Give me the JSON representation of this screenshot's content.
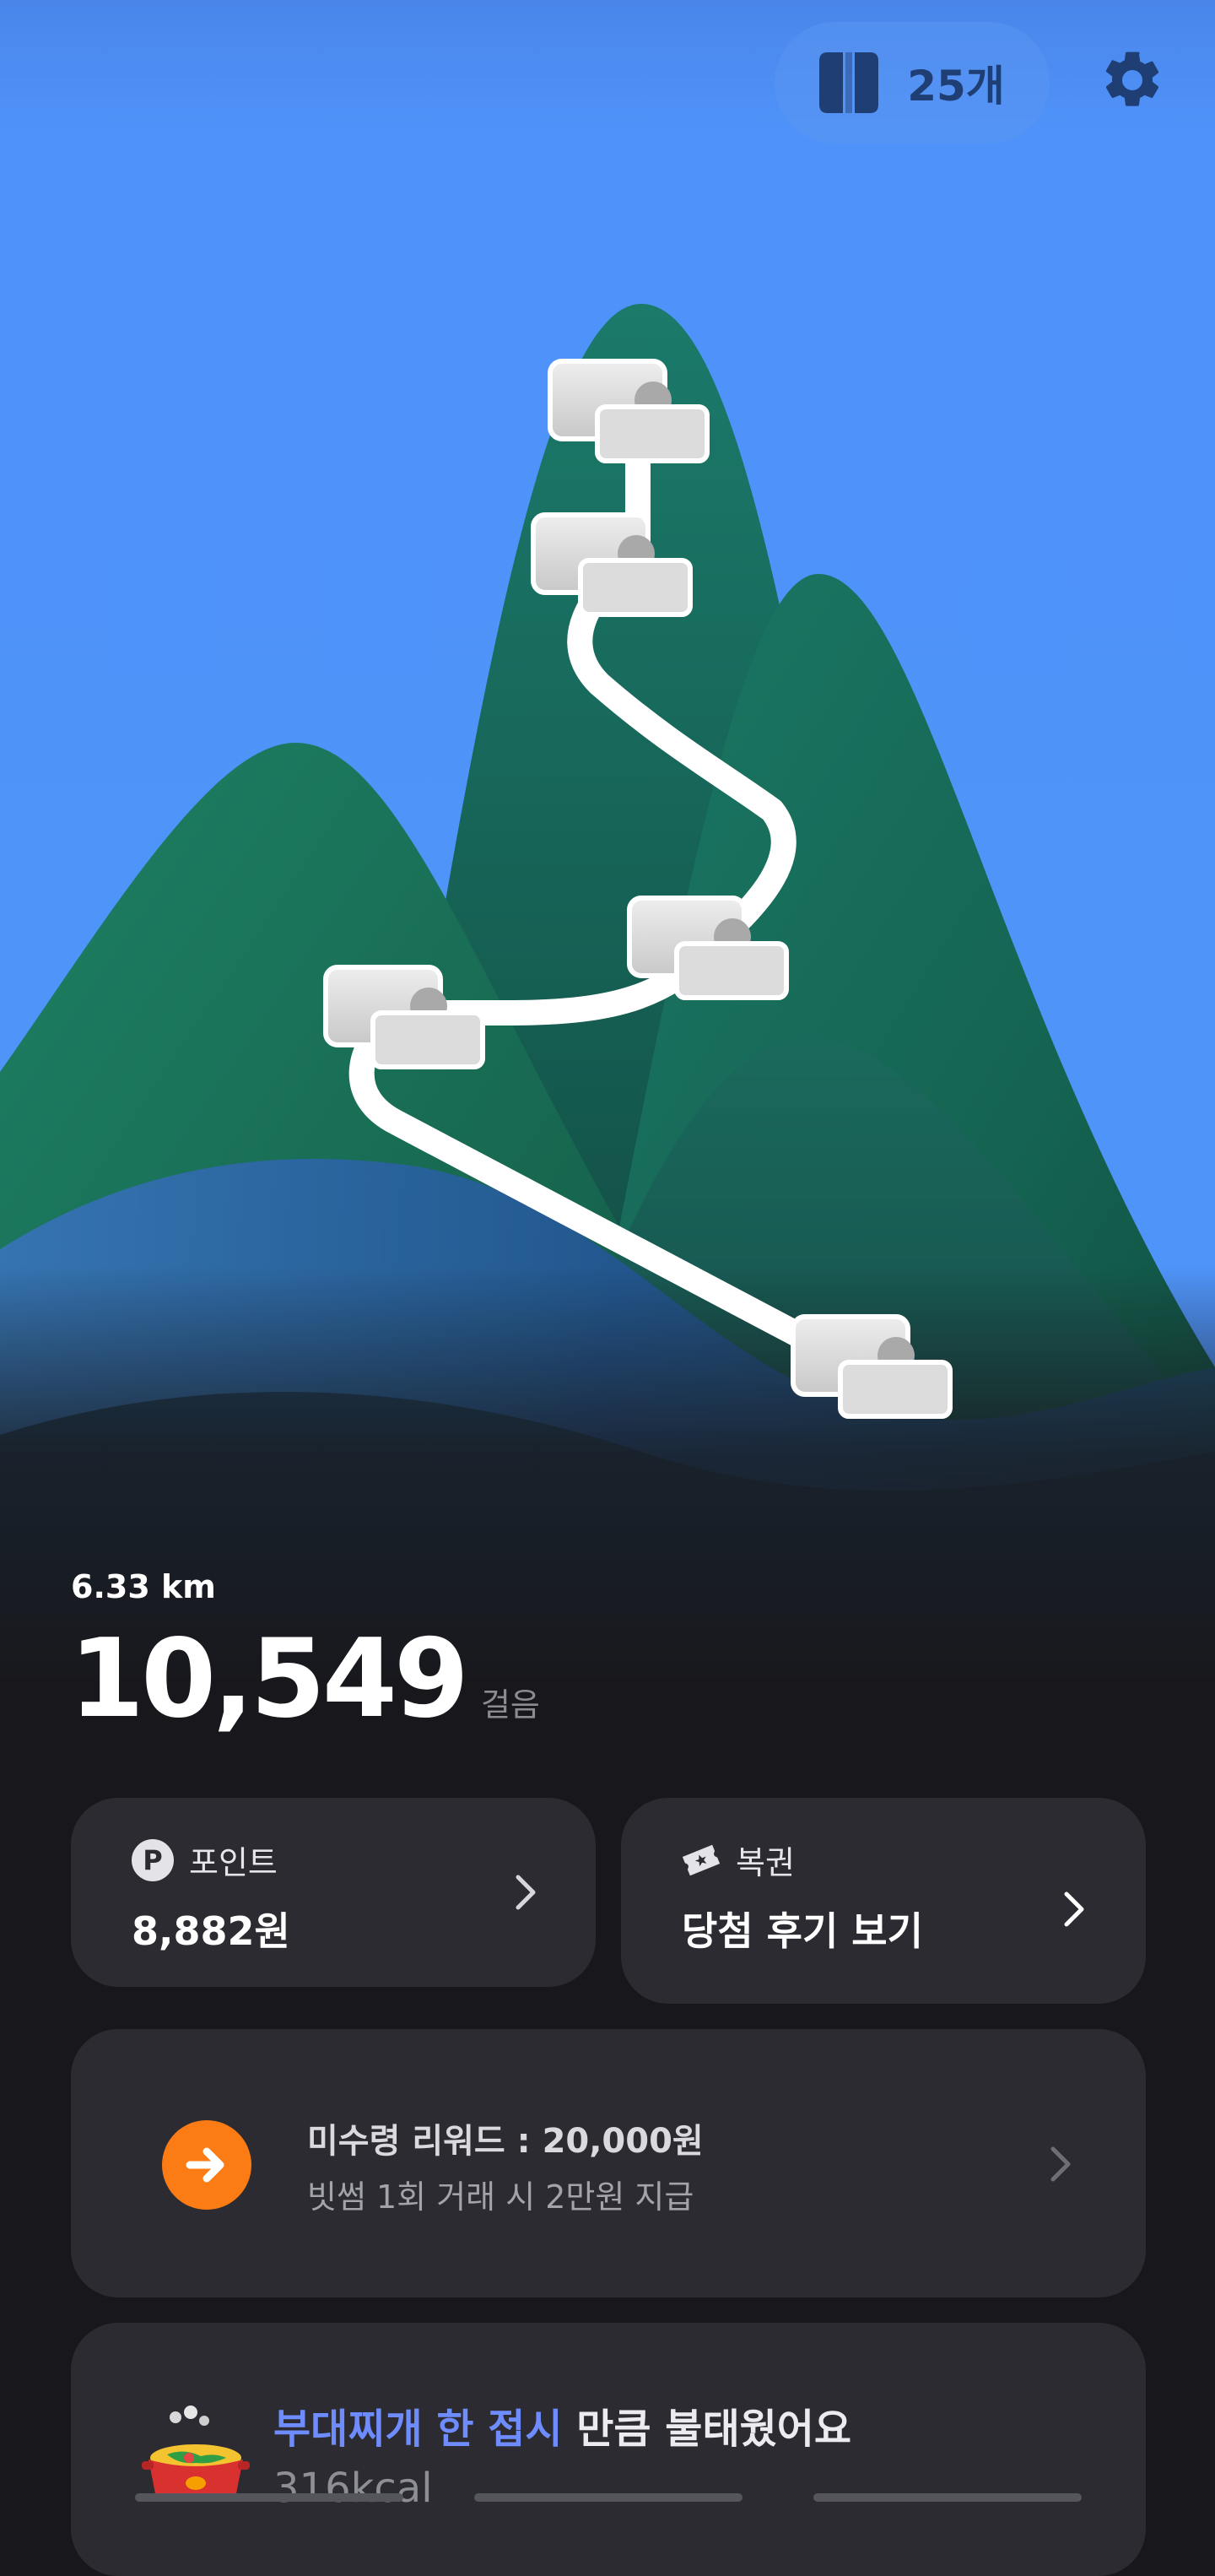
{
  "header": {
    "ticket_icon": "ticket-icon",
    "ticket_count": "25개",
    "settings_icon": "gear-icon"
  },
  "stats": {
    "distance": "6.33 km",
    "steps": "10,549",
    "steps_unit": "걸음"
  },
  "points_card": {
    "icon": "P",
    "label": "포인트",
    "value": "8,882원"
  },
  "lotto_card": {
    "icon": "ticket-star-icon",
    "label": "복권",
    "value": "당첨 후기 보기"
  },
  "reward_card": {
    "icon": "arrow-right-icon",
    "title": "미수령 리워드 : 20,000원",
    "subtitle": "빗썸 1회 거래 시 2만원 지급",
    "accent": "#fb7b14"
  },
  "burn_card": {
    "food": "부대찌개 한 접시",
    "suffix": " 만큼 불태웠어요",
    "kcal": "316kcal",
    "food_color": "#6f8cff"
  },
  "colors": {
    "sky": "#4d8ff0",
    "mountain": "#13684f",
    "background": "#18181c",
    "card": "#2b2b31"
  }
}
